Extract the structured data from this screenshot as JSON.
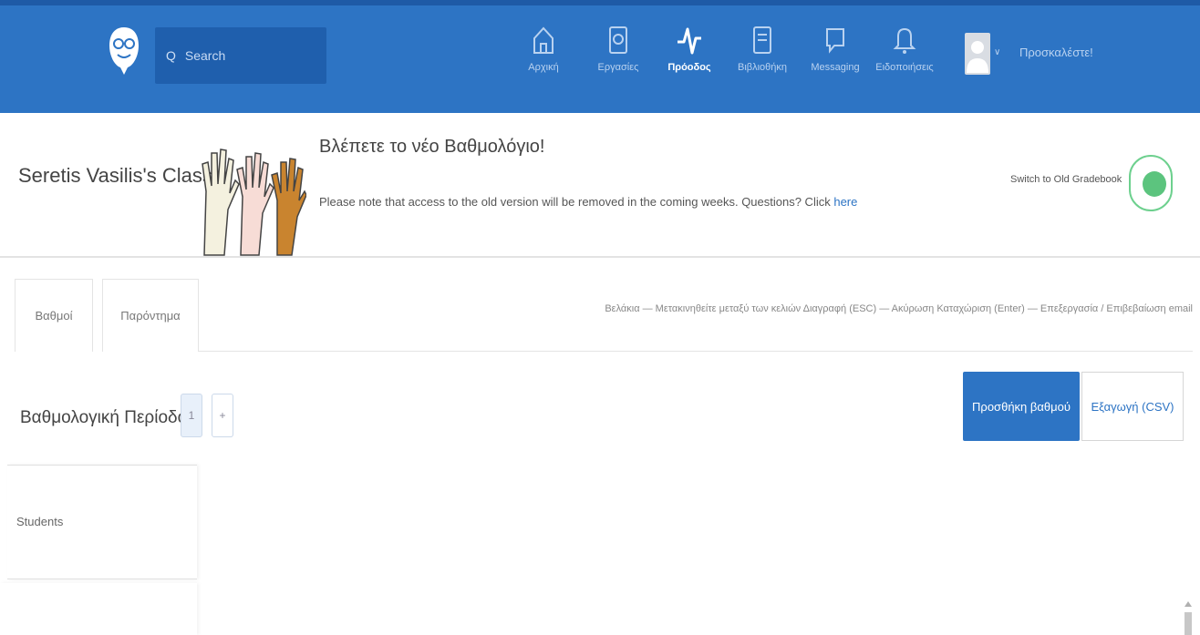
{
  "nav": {
    "search_placeholder": "Search",
    "items": [
      {
        "label": "Αρχική",
        "icon": "home-icon"
      },
      {
        "label": "Εργασίες",
        "icon": "assignments-icon"
      },
      {
        "label": "Πρόοδος",
        "icon": "progress-icon"
      },
      {
        "label": "Βιβλιοθήκη",
        "icon": "library-icon"
      },
      {
        "label": "Messaging",
        "icon": "messaging-icon"
      },
      {
        "label": "Ειδοποιήσεις",
        "icon": "bell-icon"
      }
    ],
    "active_item": "Πρόοδος",
    "user_label": "Προσκαλέστε!"
  },
  "header": {
    "class_name": "Seretis Vasilis's Class",
    "banner_title": "Βλέπετε το νέο Βαθμολόγιο!",
    "banner_text": "Please note that access to the old version will be removed in the coming weeks. Questions? Click ",
    "banner_link": "here",
    "switch_label": "Switch to Old Gradebook",
    "switch_on": true
  },
  "tabs": [
    {
      "label": "Βαθμοί"
    },
    {
      "label": "Παρόντημα"
    }
  ],
  "shortcuts": "Βελάκια — Μετακινηθείτε μεταξύ των κελιών   Διαγραφή (ESC) — Ακύρωση   Καταχώριση (Enter) — Επεξεργασία / Επιβεβαίωση email",
  "grading": {
    "period_label": "Βαθμολογική Περίοδος",
    "periods": [
      "1"
    ],
    "add_period": "+",
    "add_grade_label": "Προσθήκη βαθμού",
    "export_label": "Εξαγωγή (CSV)"
  },
  "table": {
    "students_header": "Students"
  },
  "colors": {
    "brand_blue": "#2d74c4",
    "toggle_green": "#5cc47e"
  }
}
